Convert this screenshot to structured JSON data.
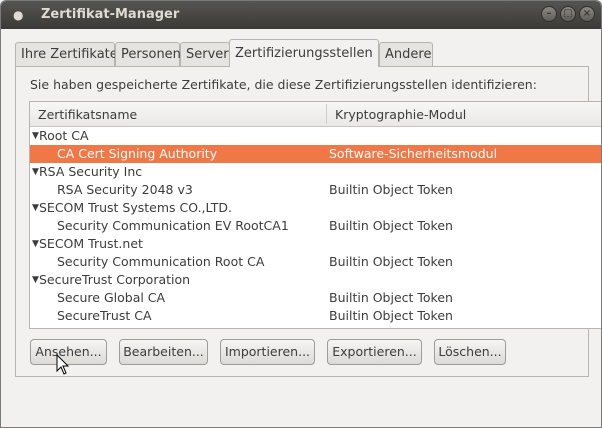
{
  "window": {
    "title": "Zertifikat-Manager"
  },
  "tabs": [
    {
      "label": "Ihre Zertifikate",
      "active": false
    },
    {
      "label": "Personen",
      "active": false
    },
    {
      "label": "Server",
      "active": false
    },
    {
      "label": "Zertifizierungsstellen",
      "active": true
    },
    {
      "label": "Andere",
      "active": false
    }
  ],
  "intro": "Sie haben gespeicherte Zertifikate, die diese Zertifizierungsstellen identifizieren:",
  "columns": {
    "name": "Zertifikatsname",
    "module": "Kryptographie-Modul"
  },
  "rows": [
    {
      "type": "group",
      "name": "Root CA",
      "module": ""
    },
    {
      "type": "cert",
      "name": "CA Cert Signing Authority",
      "module": "Software-Sicherheitsmodul",
      "selected": true
    },
    {
      "type": "group",
      "name": "RSA Security Inc",
      "module": ""
    },
    {
      "type": "cert",
      "name": "RSA Security 2048 v3",
      "module": "Builtin Object Token"
    },
    {
      "type": "group",
      "name": "SECOM Trust Systems CO.,LTD.",
      "module": ""
    },
    {
      "type": "cert",
      "name": "Security Communication EV RootCA1",
      "module": "Builtin Object Token"
    },
    {
      "type": "group",
      "name": "SECOM Trust.net",
      "module": ""
    },
    {
      "type": "cert",
      "name": "Security Communication Root CA",
      "module": "Builtin Object Token"
    },
    {
      "type": "group",
      "name": "SecureTrust Corporation",
      "module": ""
    },
    {
      "type": "cert",
      "name": "Secure Global CA",
      "module": "Builtin Object Token"
    },
    {
      "type": "cert",
      "name": "SecureTrust CA",
      "module": "Builtin Object Token"
    }
  ],
  "buttons": {
    "view": "Ansehen...",
    "edit": "Bearbeiten...",
    "import": "Importieren...",
    "export": "Exportieren...",
    "delete": "Löschen..."
  },
  "colors": {
    "selection": "#f07746",
    "titlebar": "#3b3a37"
  }
}
